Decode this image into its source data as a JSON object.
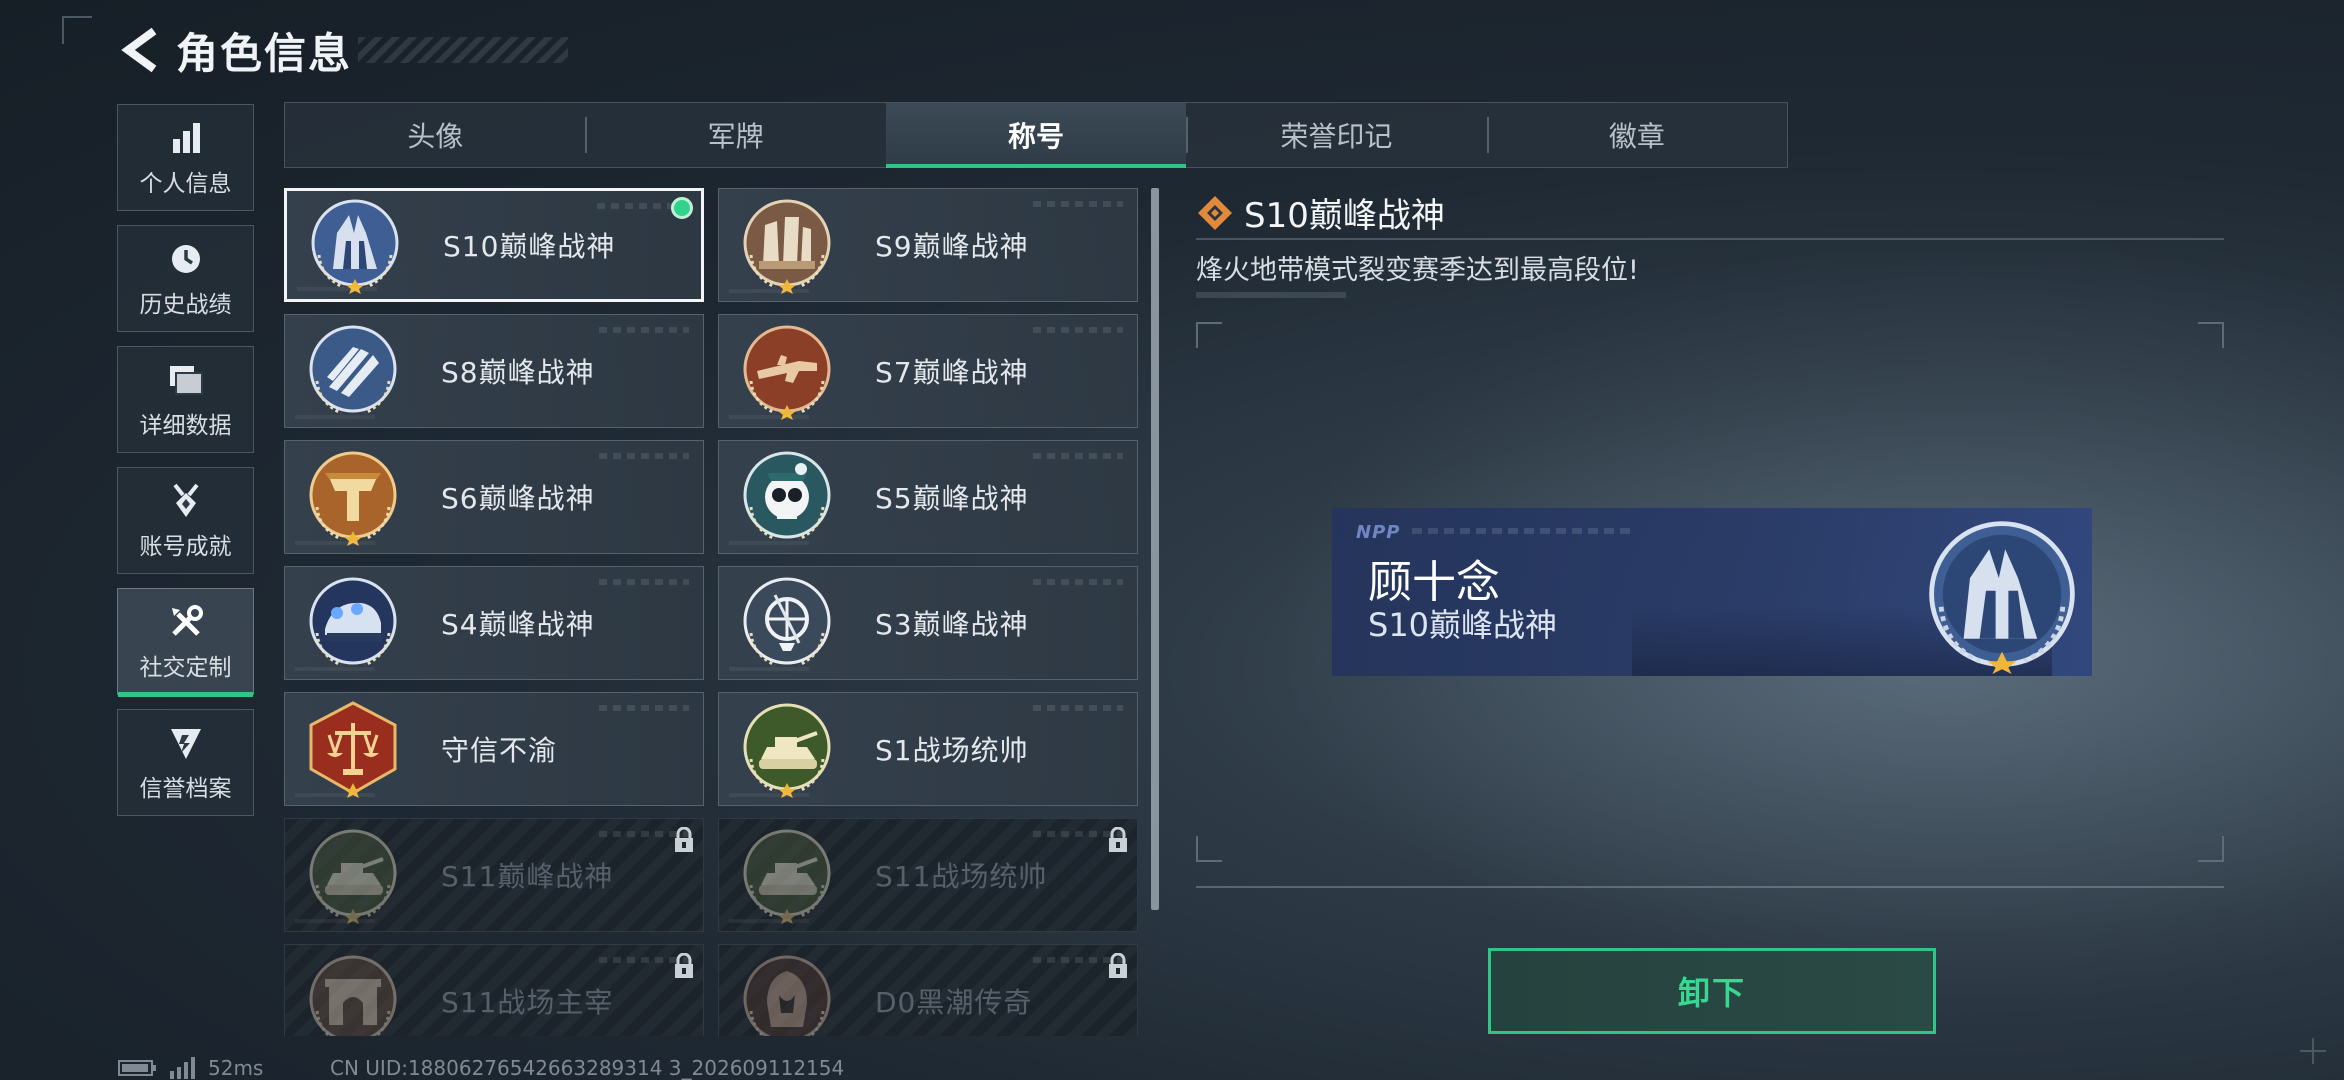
{
  "header": {
    "title": "角色信息",
    "back_icon": "back-arrow-icon"
  },
  "side_nav": [
    {
      "label": "个人信息",
      "icon": "bar-chart-icon",
      "active": false
    },
    {
      "label": "历史战绩",
      "icon": "clock-icon",
      "active": false
    },
    {
      "label": "详细数据",
      "icon": "folder-icon",
      "active": false
    },
    {
      "label": "账号成就",
      "icon": "medal-icon",
      "active": false
    },
    {
      "label": "社交定制",
      "icon": "tools-icon",
      "active": true
    },
    {
      "label": "信誉档案",
      "icon": "shield-icon",
      "active": false
    }
  ],
  "tabs": [
    {
      "label": "头像",
      "active": false
    },
    {
      "label": "军牌",
      "active": false
    },
    {
      "label": "称号",
      "active": true
    },
    {
      "label": "荣誉印记",
      "active": false
    },
    {
      "label": "徽章",
      "active": false
    }
  ],
  "titles": [
    {
      "name": "S10巅峰战神",
      "emblem": "fortress-emblem",
      "selected": true,
      "equipped": true,
      "locked": false
    },
    {
      "name": "S9巅峰战神",
      "emblem": "ruins-emblem",
      "selected": false,
      "equipped": false,
      "locked": false
    },
    {
      "name": "S8巅峰战神",
      "emblem": "stripes-emblem",
      "selected": false,
      "equipped": false,
      "locked": false
    },
    {
      "name": "S7巅峰战神",
      "emblem": "rifle-emblem",
      "selected": false,
      "equipped": false,
      "locked": false
    },
    {
      "name": "S6巅峰战神",
      "emblem": "helmet-emblem",
      "selected": false,
      "equipped": false,
      "locked": false
    },
    {
      "name": "S5巅峰战神",
      "emblem": "skull-emblem",
      "selected": false,
      "equipped": false,
      "locked": false
    },
    {
      "name": "S4巅峰战神",
      "emblem": "vehicle-emblem",
      "selected": false,
      "equipped": false,
      "locked": false
    },
    {
      "name": "S3巅峰战神",
      "emblem": "globe-emblem",
      "selected": false,
      "equipped": false,
      "locked": false
    },
    {
      "name": "守信不渝",
      "emblem": "scales-emblem",
      "selected": false,
      "equipped": false,
      "locked": false
    },
    {
      "name": "S1战场统帅",
      "emblem": "tank-emblem",
      "selected": false,
      "equipped": false,
      "locked": false
    },
    {
      "name": "S11巅峰战神",
      "emblem": "tank-emblem",
      "selected": false,
      "equipped": false,
      "locked": true
    },
    {
      "name": "S11战场统帅",
      "emblem": "tank-emblem",
      "selected": false,
      "equipped": false,
      "locked": true
    },
    {
      "name": "S11战场主宰",
      "emblem": "arch-emblem",
      "selected": false,
      "equipped": false,
      "locked": true
    },
    {
      "name": "D0黑潮传奇",
      "emblem": "hooded-emblem",
      "selected": false,
      "equipped": false,
      "locked": true
    }
  ],
  "detail": {
    "title": "S10巅峰战神",
    "description": "烽火地带模式裂变赛季达到最高段位!",
    "nameplate": {
      "logo": "NPP",
      "player_name": "顾十念",
      "title": "S10巅峰战神"
    },
    "button_label": "卸下"
  },
  "status": {
    "ping": "52ms",
    "uid": "CN UID:18806276542663289314 3_202609112154"
  },
  "colors": {
    "accent_green": "#31c487",
    "panel_bg": "#2e3a45",
    "nameplate_blue": "#2a3c6a",
    "emblem_gold": "#c9a24a",
    "emblem_bronze": "#9c5a36"
  }
}
